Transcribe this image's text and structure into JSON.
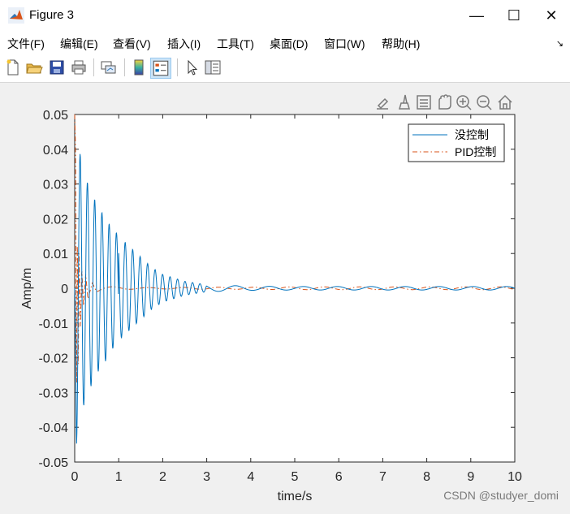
{
  "window": {
    "title": "Figure 3",
    "minimize_glyph": "—",
    "maximize_glyph": "☐",
    "close_glyph": "✕"
  },
  "menu": {
    "items": [
      "文件(F)",
      "编辑(E)",
      "查看(V)",
      "插入(I)",
      "工具(T)",
      "桌面(D)",
      "窗口(W)",
      "帮助(H)"
    ],
    "overflow_glyph": "↘"
  },
  "toolbar": {
    "buttons": [
      "new-figure-icon",
      "open-file-icon",
      "save-icon",
      "print-icon",
      "link-plot-icon",
      "colorbar-icon",
      "legend-icon",
      "pointer-icon",
      "property-editor-icon"
    ]
  },
  "axes_toolbar": {
    "buttons": [
      "export-icon",
      "brush-icon",
      "data-tips-icon",
      "pan-icon",
      "zoom-in-icon",
      "zoom-out-icon",
      "home-icon"
    ]
  },
  "chart_data": {
    "type": "line",
    "xlabel": "time/s",
    "ylabel": "Amp/m",
    "xlim": [
      0,
      10
    ],
    "ylim": [
      -0.05,
      0.05
    ],
    "xticks": [
      "0",
      "1",
      "2",
      "3",
      "4",
      "5",
      "6",
      "7",
      "8",
      "9",
      "10"
    ],
    "yticks": [
      "0.05",
      "0.04",
      "0.03",
      "0.02",
      "0.01",
      "0",
      "-0.01",
      "-0.02",
      "-0.03",
      "-0.04",
      "-0.05"
    ],
    "legend_position": "top-right",
    "series": [
      {
        "name": "没控制",
        "color": "#0072bd",
        "style": "solid",
        "x": [
          0,
          0.04,
          0.1,
          0.17,
          0.25,
          0.33,
          0.42,
          0.5,
          0.6,
          0.7,
          0.8,
          0.9,
          1.0,
          1.25,
          1.5,
          1.75,
          2.0,
          2.5,
          3.0,
          3.5,
          4.0,
          5.0,
          6.0,
          7.0,
          8.0,
          9.0,
          10.0
        ],
        "values": [
          0,
          -0.045,
          0.04,
          -0.036,
          0.031,
          -0.03,
          0.026,
          -0.025,
          0.022,
          -0.021,
          0.018,
          -0.017,
          0.015,
          0.012,
          0.009,
          0.006,
          0.004,
          0.002,
          0.001,
          0.0008,
          0.0006,
          0.0005,
          0.0005,
          0.0005,
          0.0005,
          0.0005,
          0.0005
        ]
      },
      {
        "name": "PID控制",
        "color": "#d95319",
        "style": "dash-dot",
        "x": [
          0,
          0.02,
          0.04,
          0.06,
          0.08,
          0.1,
          0.13,
          0.16,
          0.2,
          0.25,
          0.3,
          0.4,
          0.5,
          0.7,
          1.0,
          1.5,
          2.0,
          3.0,
          4.0,
          5.0,
          6.0,
          7.0,
          8.0,
          9.0,
          10.0
        ],
        "values": [
          0.05,
          0.04,
          -0.035,
          0.02,
          -0.025,
          0.01,
          -0.012,
          0.006,
          -0.005,
          0.004,
          -0.003,
          0.0015,
          -0.001,
          0.0005,
          -0.0004,
          0.0002,
          -0.0002,
          0.0003,
          -0.0003,
          0.0004,
          -0.0004,
          0.0004,
          -0.0004,
          0.0004,
          -0.0004
        ]
      }
    ]
  },
  "watermark": "CSDN @studyer_domi"
}
